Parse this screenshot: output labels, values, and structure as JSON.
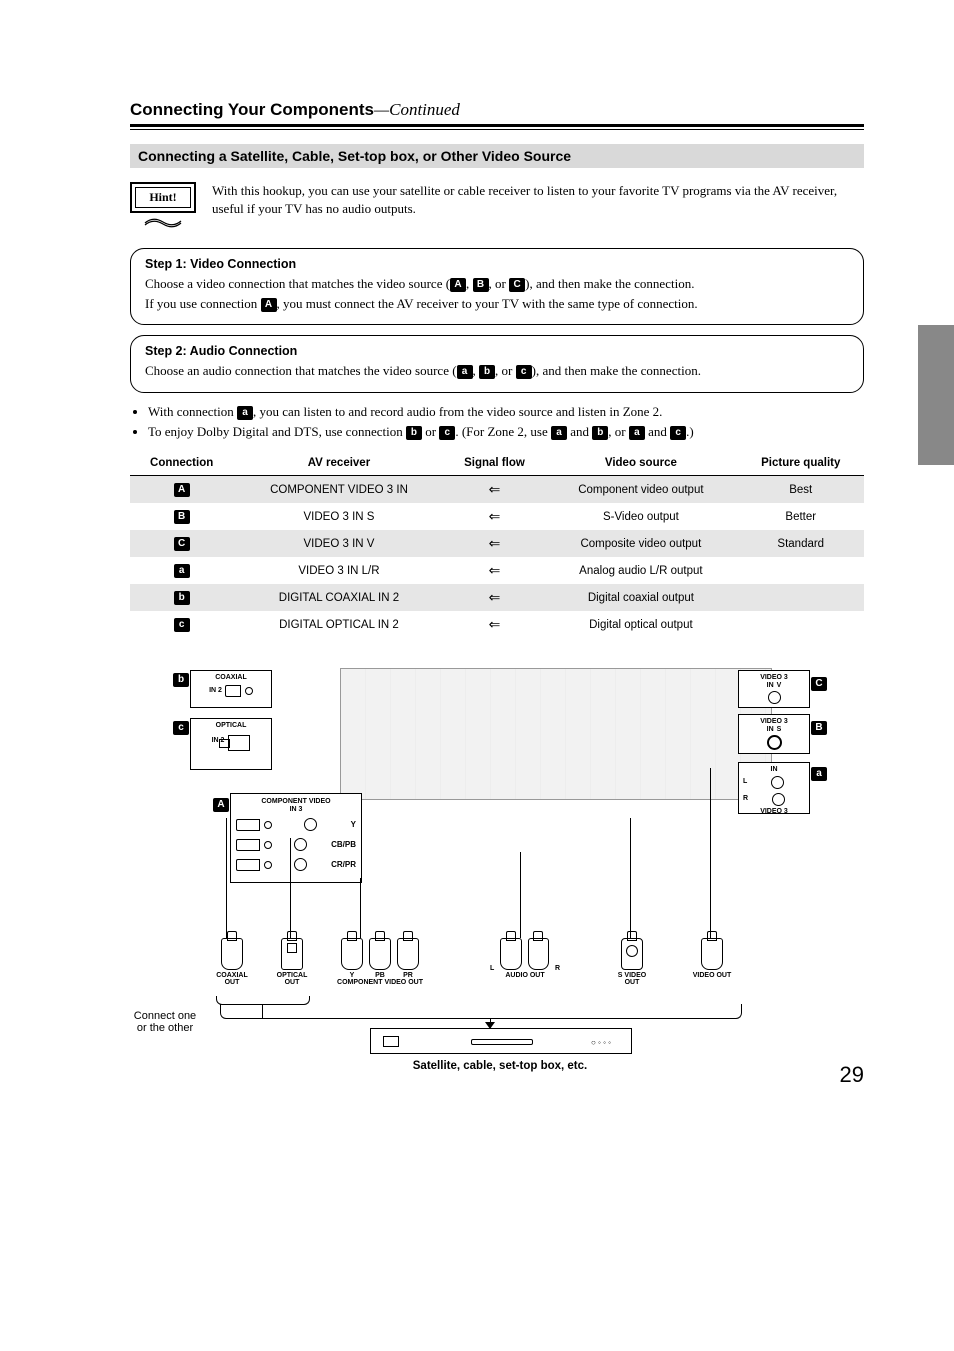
{
  "pageTitle": "Connecting Your Components",
  "pageTitleCont": "—Continued",
  "sectionHeading": "Connecting a Satellite, Cable, Set-top box, or Other Video Source",
  "hint": {
    "label": "Hint!",
    "text": "With this hookup, you can use your satellite or cable receiver to listen to your favorite TV programs via the AV receiver, useful if your TV has no audio outputs."
  },
  "step1": {
    "title": "Step 1: Video Connection",
    "line1a": "Choose a video connection that matches the video source (",
    "line1b": "), and then make the connection.",
    "line2a": "If you use connection ",
    "line2b": ", you must connect the AV receiver to your TV with the same type of connection."
  },
  "step2": {
    "title": "Step 2: Audio Connection",
    "line1a": "Choose an audio connection that matches the video source (",
    "line1b": "), and then make the connection."
  },
  "bullets": {
    "b1a": "With connection ",
    "b1b": ", you can listen to and record audio from the video source and listen in Zone 2.",
    "b2a": "To enjoy Dolby Digital and DTS, use connection ",
    "b2b": ". (For Zone 2, use ",
    "b2c": ", or ",
    "b2d": ".)"
  },
  "tags": {
    "A": "A",
    "B": "B",
    "C": "C",
    "a": "a",
    "b": "b",
    "c": "c",
    "or": ", or ",
    "comma": ", ",
    "and": " and "
  },
  "table": {
    "headers": {
      "connection": "Connection",
      "receiver": "AV receiver",
      "flow": "Signal flow",
      "source": "Video source",
      "quality": "Picture quality"
    },
    "rows": [
      {
        "tag": "A",
        "receiver": "COMPONENT VIDEO 3 IN",
        "flow": "⇐",
        "source": "Component video output",
        "quality": "Best",
        "shade": true
      },
      {
        "tag": "B",
        "receiver": "VIDEO 3 IN S",
        "flow": "⇐",
        "source": "S-Video output",
        "quality": "Better",
        "shade": false
      },
      {
        "tag": "C",
        "receiver": "VIDEO 3 IN V",
        "flow": "⇐",
        "source": "Composite video output",
        "quality": "Standard",
        "shade": true
      },
      {
        "tag": "a",
        "receiver": "VIDEO 3 IN L/R",
        "flow": "⇐",
        "source": "Analog audio L/R output",
        "quality": "",
        "shade": false
      },
      {
        "tag": "b",
        "receiver": "DIGITAL COAXIAL IN 2",
        "flow": "⇐",
        "source": "Digital coaxial output",
        "quality": "",
        "shade": true
      },
      {
        "tag": "c",
        "receiver": "DIGITAL OPTICAL IN 2",
        "flow": "⇐",
        "source": "Digital optical output",
        "quality": "",
        "shade": false
      }
    ]
  },
  "diagram": {
    "coaxialLabel": "COAXIAL",
    "in2Label": "IN 2",
    "opticalLabel": "OPTICAL",
    "compLabel": "COMPONENT VIDEO",
    "in3Label": "IN 3",
    "y": "Y",
    "pb": "CB/PB",
    "pr": "CR/PR",
    "video3": "VIDEO 3",
    "inV": "IN",
    "v": "V",
    "s": "S",
    "l": "L",
    "r": "R",
    "outs": {
      "coax": "COAXIAL OUT",
      "opt": "OPTICAL OUT",
      "comp": "COMPONENT VIDEO OUT",
      "compY": "Y",
      "compPb": "PB",
      "compPr": "PR",
      "audio": "AUDIO OUT",
      "audioL": "L",
      "audioR": "R",
      "svideo": "S VIDEO OUT",
      "video": "VIDEO OUT"
    },
    "connectNote1": "Connect one",
    "connectNote2": "or the other",
    "caption": "Satellite, cable, set-top box, etc."
  },
  "pageNumber": "29"
}
